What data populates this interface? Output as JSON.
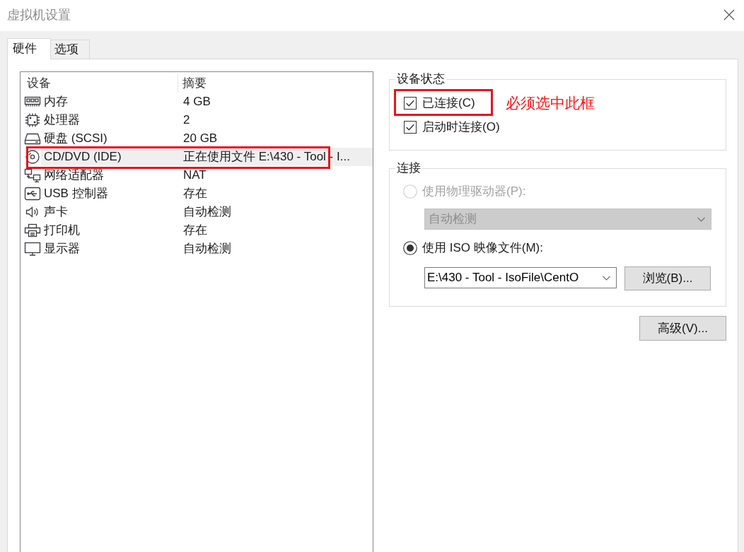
{
  "window": {
    "title": "虚拟机设置"
  },
  "tabs": [
    {
      "label": "硬件",
      "selected": true
    },
    {
      "label": "选项",
      "selected": false
    }
  ],
  "device_list": {
    "columns": [
      "设备",
      "摘要"
    ],
    "rows": [
      {
        "kind": "memory",
        "device": "内存",
        "summary": "4 GB",
        "selected": false,
        "highlighted": false
      },
      {
        "kind": "processor",
        "device": "处理器",
        "summary": "2",
        "selected": false,
        "highlighted": false
      },
      {
        "kind": "disk",
        "device": "硬盘 (SCSI)",
        "summary": "20 GB",
        "selected": false,
        "highlighted": false
      },
      {
        "kind": "cd",
        "device": "CD/DVD (IDE)",
        "summary": "正在使用文件 E:\\430 - Tool - I...",
        "selected": true,
        "highlighted": true
      },
      {
        "kind": "network",
        "device": "网络适配器",
        "summary": "NAT",
        "selected": false,
        "highlighted": false
      },
      {
        "kind": "usb",
        "device": "USB 控制器",
        "summary": "存在",
        "selected": false,
        "highlighted": false
      },
      {
        "kind": "sound",
        "device": "声卡",
        "summary": "自动检测",
        "selected": false,
        "highlighted": false
      },
      {
        "kind": "printer",
        "device": "打印机",
        "summary": "存在",
        "selected": false,
        "highlighted": false
      },
      {
        "kind": "display",
        "device": "显示器",
        "summary": "自动检测",
        "selected": false,
        "highlighted": false
      }
    ]
  },
  "device_status": {
    "title": "设备状态",
    "checkboxes": [
      {
        "label": "已连接(C)",
        "checked": true,
        "highlighted": true,
        "note": "必须选中此框"
      },
      {
        "label": "启动时连接(O)",
        "checked": true,
        "highlighted": false
      }
    ]
  },
  "connection": {
    "title": "连接",
    "options": [
      {
        "label": "使用物理驱动器(P):",
        "selected": false,
        "disabled": true,
        "field": {
          "kind": "select",
          "value": "自动检测"
        }
      },
      {
        "label": "使用 ISO 映像文件(M):",
        "selected": true,
        "disabled": false,
        "field": {
          "kind": "combo",
          "value": "E:\\430 - Tool - IsoFile\\CentO"
        },
        "button": "浏览(B)..."
      }
    ]
  },
  "advanced_button": "高级(V)..."
}
